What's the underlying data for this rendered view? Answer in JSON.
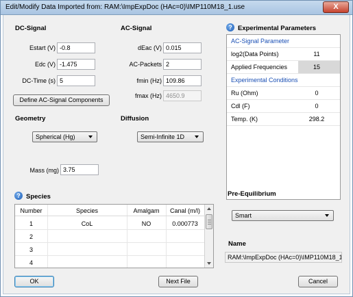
{
  "window": {
    "title": "Edit/Modify Data Imported from:  RAM:\\ImpExpDoc (HAc=0)\\IMP110M18_1.use",
    "close_glyph": "X"
  },
  "dc_signal": {
    "heading": "DC-Signal",
    "estart_label": "Estart (V)",
    "estart_value": "-0.8",
    "edc_label": "Edc (V)",
    "edc_value": "-1.475",
    "dctime_label": "DC-Time (s)",
    "dctime_value": "5",
    "define_button": "Define AC-Signal Components"
  },
  "ac_signal": {
    "heading": "AC-Signal",
    "deac_label": "dEac (V)",
    "deac_value": "0.015",
    "packets_label": "AC-Packets",
    "packets_value": "2",
    "fmin_label": "fmin (Hz)",
    "fmin_value": "109.86",
    "fmax_label": "fmax (Hz)",
    "fmax_value": "4650.9"
  },
  "experimental": {
    "heading": "Experimental Parameters",
    "rows": [
      {
        "key": "AC-Signal Parameter",
        "value": ""
      },
      {
        "key": "log2(Data Points)",
        "value": "11"
      },
      {
        "key": "Applied Frequencies",
        "value": "15"
      },
      {
        "key": "Experimental Conditions",
        "value": ""
      },
      {
        "key": "Ru (Ohm)",
        "value": "0"
      },
      {
        "key": "Cdl (F)",
        "value": "0"
      },
      {
        "key": "Temp. (K)",
        "value": "298.2"
      }
    ]
  },
  "geometry": {
    "heading": "Geometry",
    "selected": "Spherical (Hg)",
    "mass_label": "Mass (mg)",
    "mass_value": "3.75"
  },
  "diffusion": {
    "heading": "Diffusion",
    "selected": "Semi-Infinite 1D"
  },
  "pre_equilibrium": {
    "heading": "Pre-Equilibrium",
    "selected": "Smart"
  },
  "name_section": {
    "heading": "Name",
    "value": "RAM:\\ImpExpDoc (HAc=0)\\IMP110M18_1"
  },
  "species": {
    "heading": "Species",
    "columns": [
      "Number",
      "Species",
      "Amalgam",
      "Canal (m/l)"
    ],
    "rows": [
      {
        "number": "1",
        "species": "CoL",
        "amalgam": "NO",
        "canal": "0.000773"
      },
      {
        "number": "2",
        "species": "",
        "amalgam": "",
        "canal": ""
      },
      {
        "number": "3",
        "species": "",
        "amalgam": "",
        "canal": ""
      },
      {
        "number": "4",
        "species": "",
        "amalgam": "",
        "canal": ""
      }
    ]
  },
  "buttons": {
    "ok": "OK",
    "next_file": "Next File",
    "cancel": "Cancel"
  },
  "icons": {
    "help": "?"
  }
}
